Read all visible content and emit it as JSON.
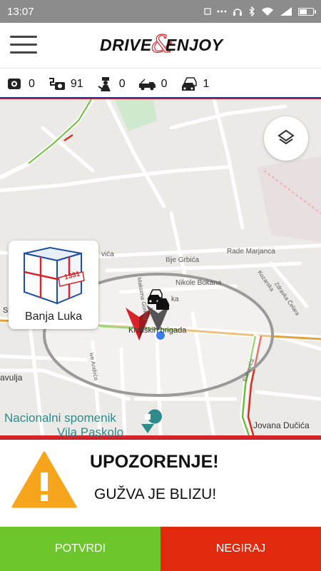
{
  "status_bar": {
    "time": "13:07",
    "wifi_icon": "wifi-icon",
    "signal_icon": "signal-icon",
    "battery_icon": "battery-icon",
    "battery_level": 0.6
  },
  "header": {
    "menu_icon": "hamburger-menu-icon",
    "logo": {
      "part1": "DRIVE",
      "ampersand": "&",
      "part2": "ENJOY"
    }
  },
  "stats": [
    {
      "icon": "speed-camera-icon",
      "value": "0"
    },
    {
      "icon": "radar-camera-icon",
      "value": "91"
    },
    {
      "icon": "police-officer-icon",
      "value": "0"
    },
    {
      "icon": "tow-truck-icon",
      "value": "0"
    },
    {
      "icon": "traffic-jam-icon",
      "value": "1"
    }
  ],
  "map": {
    "street_labels": [
      "vića",
      "Ilije Grbića",
      "Rade Marjanca",
      "Nikole Bokana",
      "Maksima Gorkog",
      "ka",
      "Kozarska",
      "Zdravka Čelara",
      "Krajiških brigada",
      "ive Andrića",
      "Đakovića",
      "avulja",
      "Jovana Dučića",
      "Sv"
    ],
    "poi": {
      "line1": "Nacionalni spomenik",
      "line2": "Vila Paskolo"
    },
    "layers_button_icon": "layers-icon",
    "city_card": {
      "name": "Banja Luka",
      "box_label": "1331"
    }
  },
  "warning": {
    "title": "UPOZORENJE!",
    "message": "GUŽVA JE BLIZU!",
    "icon": "warning-triangle-icon"
  },
  "actions": {
    "confirm": "POTVRDI",
    "deny": "NEGIRAJ"
  },
  "colors": {
    "brand_red": "#d7232a",
    "brand_blue": "#1f3e9c",
    "confirm_green": "#6cc62c",
    "deny_red": "#e1290d",
    "warning_orange": "#f7a51c"
  }
}
